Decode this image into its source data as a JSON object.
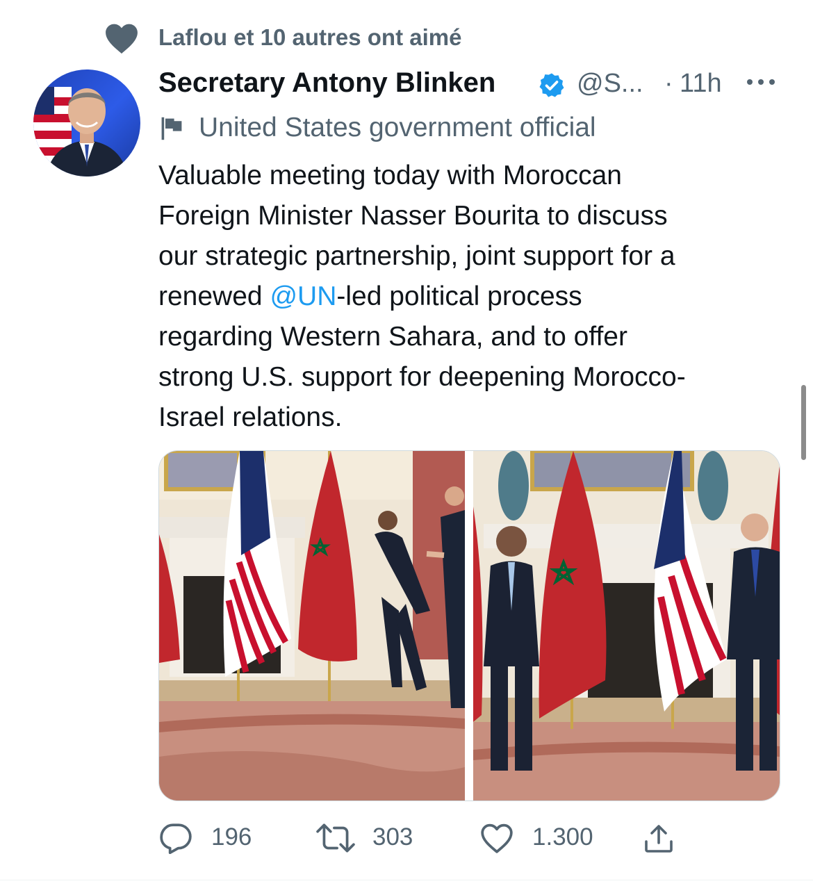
{
  "social_context": {
    "text": "Laflou et 10 autres ont aimé",
    "icon": "heart-filled-icon"
  },
  "author": {
    "display_name": "Secretary Antony Blinken",
    "handle": "@S...",
    "verified": true,
    "separator": "·",
    "time": "11h",
    "label": "United States government official"
  },
  "tweet": {
    "text_before": "Valuable meeting today with Moroccan\nForeign Minister Nasser Bourita to discuss\nour strategic partnership, joint support for a\nrenewed ",
    "mention": "@UN",
    "text_after": "-led political process\nregarding Western Sahara, and to offer\nstrong U.S. support for deepening Morocco-\nIsrael relations."
  },
  "media": {
    "count": 2
  },
  "actions": {
    "replies": "196",
    "retweets": "303",
    "likes": "1.300"
  },
  "colors": {
    "text_primary": "#0f1419",
    "text_secondary": "#536471",
    "link": "#1d9bf0",
    "verified": "#1d9bf0"
  }
}
